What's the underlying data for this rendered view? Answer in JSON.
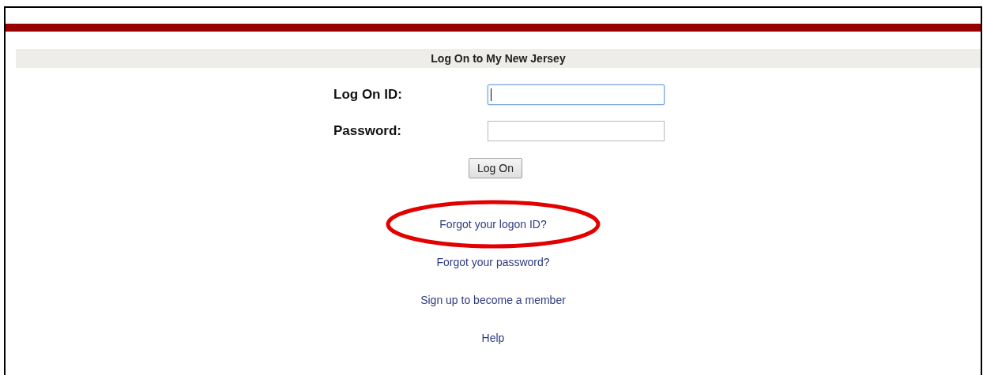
{
  "header": {
    "title": "Log On to My New Jersey"
  },
  "fields": [
    {
      "label": "Log On ID:",
      "focused": true
    },
    {
      "label": "Password:",
      "focused": false
    }
  ],
  "button": {
    "label": "Log On"
  },
  "links": [
    {
      "label": "Forgot your logon ID?",
      "circled": true
    },
    {
      "label": "Forgot your password?",
      "circled": false
    },
    {
      "label": "Sign up to become a member",
      "circled": false
    },
    {
      "label": "Help",
      "circled": false
    }
  ]
}
